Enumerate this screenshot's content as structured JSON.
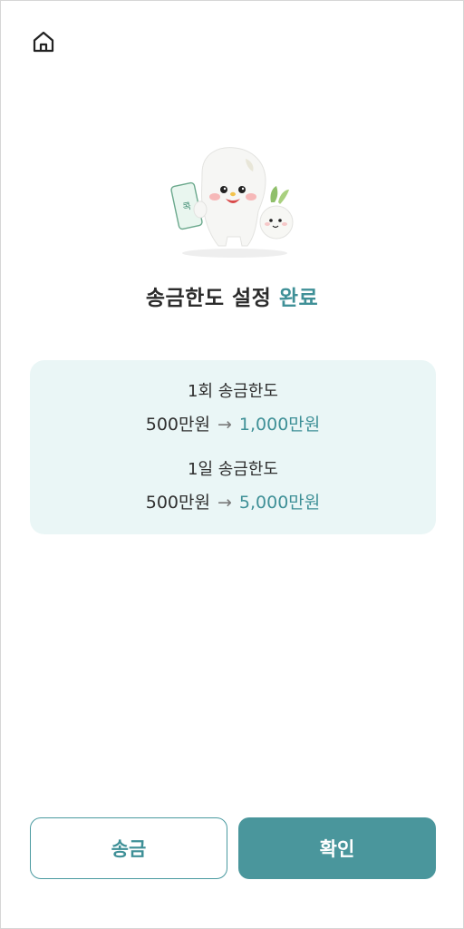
{
  "header": {
    "home_icon": "home-icon"
  },
  "hero": {
    "mascot": "mascot-illustration",
    "phone_text": "콕"
  },
  "title": {
    "main": "송금한도 설정",
    "accent": "완료",
    "accent_color": "#3f9097"
  },
  "limits": [
    {
      "label": "1회 송금한도",
      "old": "500만원",
      "arrow": "→",
      "new": "1,000만원"
    },
    {
      "label": "1일 송금한도",
      "old": "500만원",
      "arrow": "→",
      "new": "5,000만원"
    }
  ],
  "buttons": {
    "transfer_label": "송금",
    "confirm_label": "확인"
  },
  "colors": {
    "primary": "#4a969c",
    "card_bg": "#eaf6f6"
  }
}
